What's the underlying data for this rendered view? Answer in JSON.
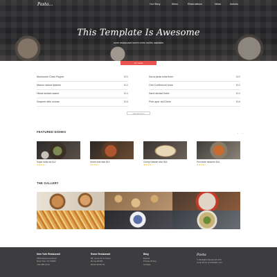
{
  "nav": {
    "logo": "Pasta...",
    "items": [
      "Our Story",
      "Menu",
      "Reservations",
      "News",
      "Actions"
    ]
  },
  "hero": {
    "title": "This Template Is Awesome",
    "subtitle": "cenn restaurant lorem enim mollis natofatio"
  },
  "menu": {
    "tab_label": "our menu",
    "left": [
      {
        "name": "Mushroom Chick Pepper",
        "price": "$20"
      },
      {
        "name": "Manus natura lipsines",
        "price": "$12"
      },
      {
        "name": "Hinda stollain acane",
        "price": "$14"
      },
      {
        "name": "Sospere ditle curnas",
        "price": "$18"
      }
    ],
    "right": [
      {
        "name": "Surra peda mnis firem",
        "price": "$20"
      },
      {
        "name": "Orni Confimicuri tome",
        "price": "$12"
      },
      {
        "name": "Sarel dicidat Geire",
        "price": "$14"
      },
      {
        "name": "Prim aper dui Dimm",
        "price": "$18"
      }
    ],
    "view_all": "view all menu"
  },
  "featured": {
    "title": "FEATURED DISHES",
    "arrows": [
      "‹",
      "›"
    ],
    "dishes": [
      {
        "name": "Super dolla dot",
        "price": "$12",
        "stars": "★★★★☆"
      },
      {
        "name": "Greek lime dish",
        "price": "$19",
        "stars": "★★★★☆"
      },
      {
        "name": "Cherry Dessert dish",
        "price": "$16",
        "stars": "★★★★☆"
      },
      {
        "name": "Pen ferde mixtures",
        "price": "$16",
        "stars": "★★★★☆"
      }
    ]
  },
  "gallery": {
    "title": "THE GALLERY"
  },
  "footer": {
    "col1": {
      "head": "New York Restaurant",
      "lines": [
        "3490 Awesome Road",
        "New York, NY 00456",
        "718-788-3744"
      ]
    },
    "col2": {
      "head": "Rome Restaurant",
      "lines": [
        "86, via de la Corrente",
        "Roma 00456",
        "06.55.35.55.78"
      ]
    },
    "col3": {
      "head": "Blog",
      "lines": [
        "Events",
        "Private Dining",
        "Contact"
      ]
    },
    "col4": {
      "logo": "Pasta",
      "lines": [
        "© All Rights Reserved 2XX",
        "Code Done at Pastabb.com"
      ]
    }
  },
  "colors": {
    "accent": "#e9524f",
    "footer_bg": "#3d3d3f",
    "stars": "#f0b400"
  }
}
